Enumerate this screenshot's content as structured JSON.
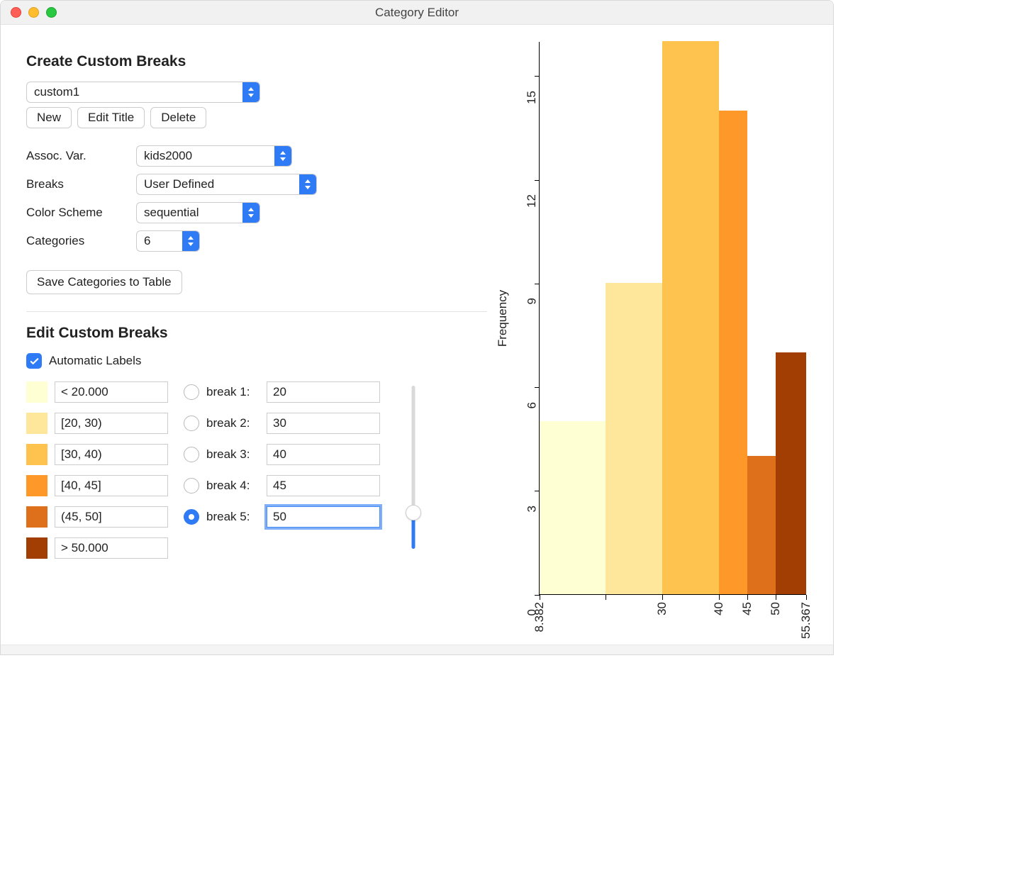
{
  "window": {
    "title": "Category Editor"
  },
  "create": {
    "heading": "Create Custom Breaks",
    "custom_name": "custom1",
    "buttons": {
      "new": "New",
      "edit_title": "Edit Title",
      "delete": "Delete"
    },
    "fields": {
      "assoc_var_label": "Assoc. Var.",
      "assoc_var_value": "kids2000",
      "breaks_label": "Breaks",
      "breaks_value": "User Defined",
      "color_scheme_label": "Color Scheme",
      "color_scheme_value": "sequential",
      "categories_label": "Categories",
      "categories_value": "6"
    },
    "save_button": "Save Categories to Table"
  },
  "edit": {
    "heading": "Edit Custom Breaks",
    "auto_labels_text": "Automatic Labels",
    "auto_labels_checked": true,
    "categories": [
      {
        "color": "#ffffd4",
        "label": "< 20.000"
      },
      {
        "color": "#fee79a",
        "label": "[20, 30)"
      },
      {
        "color": "#fec34e",
        "label": "[30, 40)"
      },
      {
        "color": "#fe9828",
        "label": "[40, 45]"
      },
      {
        "color": "#de6f1b",
        "label": "(45, 50]"
      },
      {
        "color": "#a23e04",
        "label": "> 50.000"
      }
    ],
    "breaks": [
      {
        "label": "break 1:",
        "value": "20",
        "selected": false
      },
      {
        "label": "break 2:",
        "value": "30",
        "selected": false
      },
      {
        "label": "break 3:",
        "value": "40",
        "selected": false
      },
      {
        "label": "break 4:",
        "value": "45",
        "selected": false
      },
      {
        "label": "break 5:",
        "value": "50",
        "selected": true
      }
    ],
    "slider": {
      "min": 0,
      "max": 100,
      "value": 22
    }
  },
  "chart_data": {
    "type": "bar",
    "ylabel": "Frequency",
    "ylim": [
      0,
      16
    ],
    "yticks": [
      0,
      3,
      6,
      9,
      12,
      15
    ],
    "x_breaks": [
      8.382,
      20,
      30,
      40,
      45,
      50,
      55.367
    ],
    "x_tick_labels": [
      "8.382",
      "",
      "30",
      "40",
      "45",
      "50",
      "55.367"
    ],
    "values": [
      5,
      9,
      16,
      14,
      4,
      7
    ],
    "colors": [
      "#ffffd4",
      "#fee79a",
      "#fec34e",
      "#fe9828",
      "#de6f1b",
      "#a23e04"
    ]
  }
}
